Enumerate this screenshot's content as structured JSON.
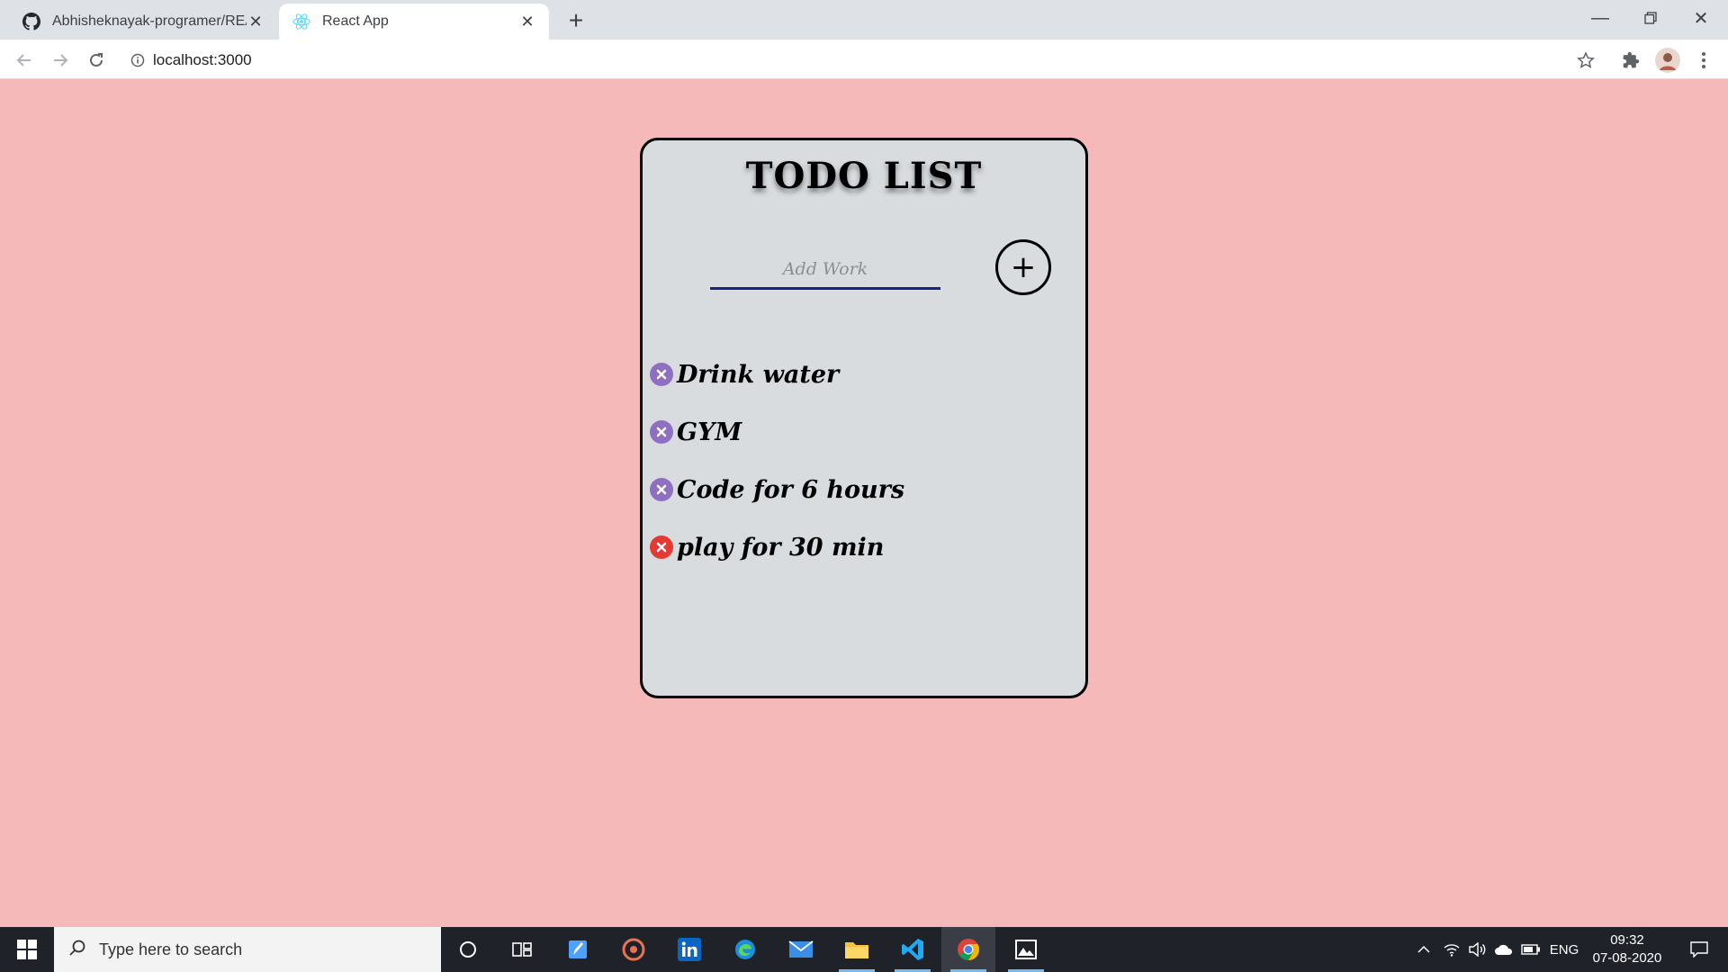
{
  "browser": {
    "tabs": [
      {
        "title": "Abhisheknayak-programer/REAC",
        "icon": "github-icon"
      },
      {
        "title": "React App",
        "icon": "react-icon"
      }
    ],
    "address": "localhost:3000"
  },
  "app": {
    "title": "TODO LIST",
    "input_placeholder": "Add Work",
    "add_label": "+",
    "items": [
      {
        "text": "Drink water"
      },
      {
        "text": "GYM"
      },
      {
        "text": "Code for 6 hours"
      },
      {
        "text": "play for 30 min"
      }
    ],
    "colors": {
      "background": "#f5b9b9",
      "card": "#d8dcdf",
      "delete_icon": "#8f6fbf",
      "delete_icon_hover": "#e53935",
      "input_underline": "#1a237e"
    }
  },
  "taskbar": {
    "search_placeholder": "Type here to search",
    "language": "ENG",
    "time": "09:32",
    "date": "07-08-2020"
  }
}
